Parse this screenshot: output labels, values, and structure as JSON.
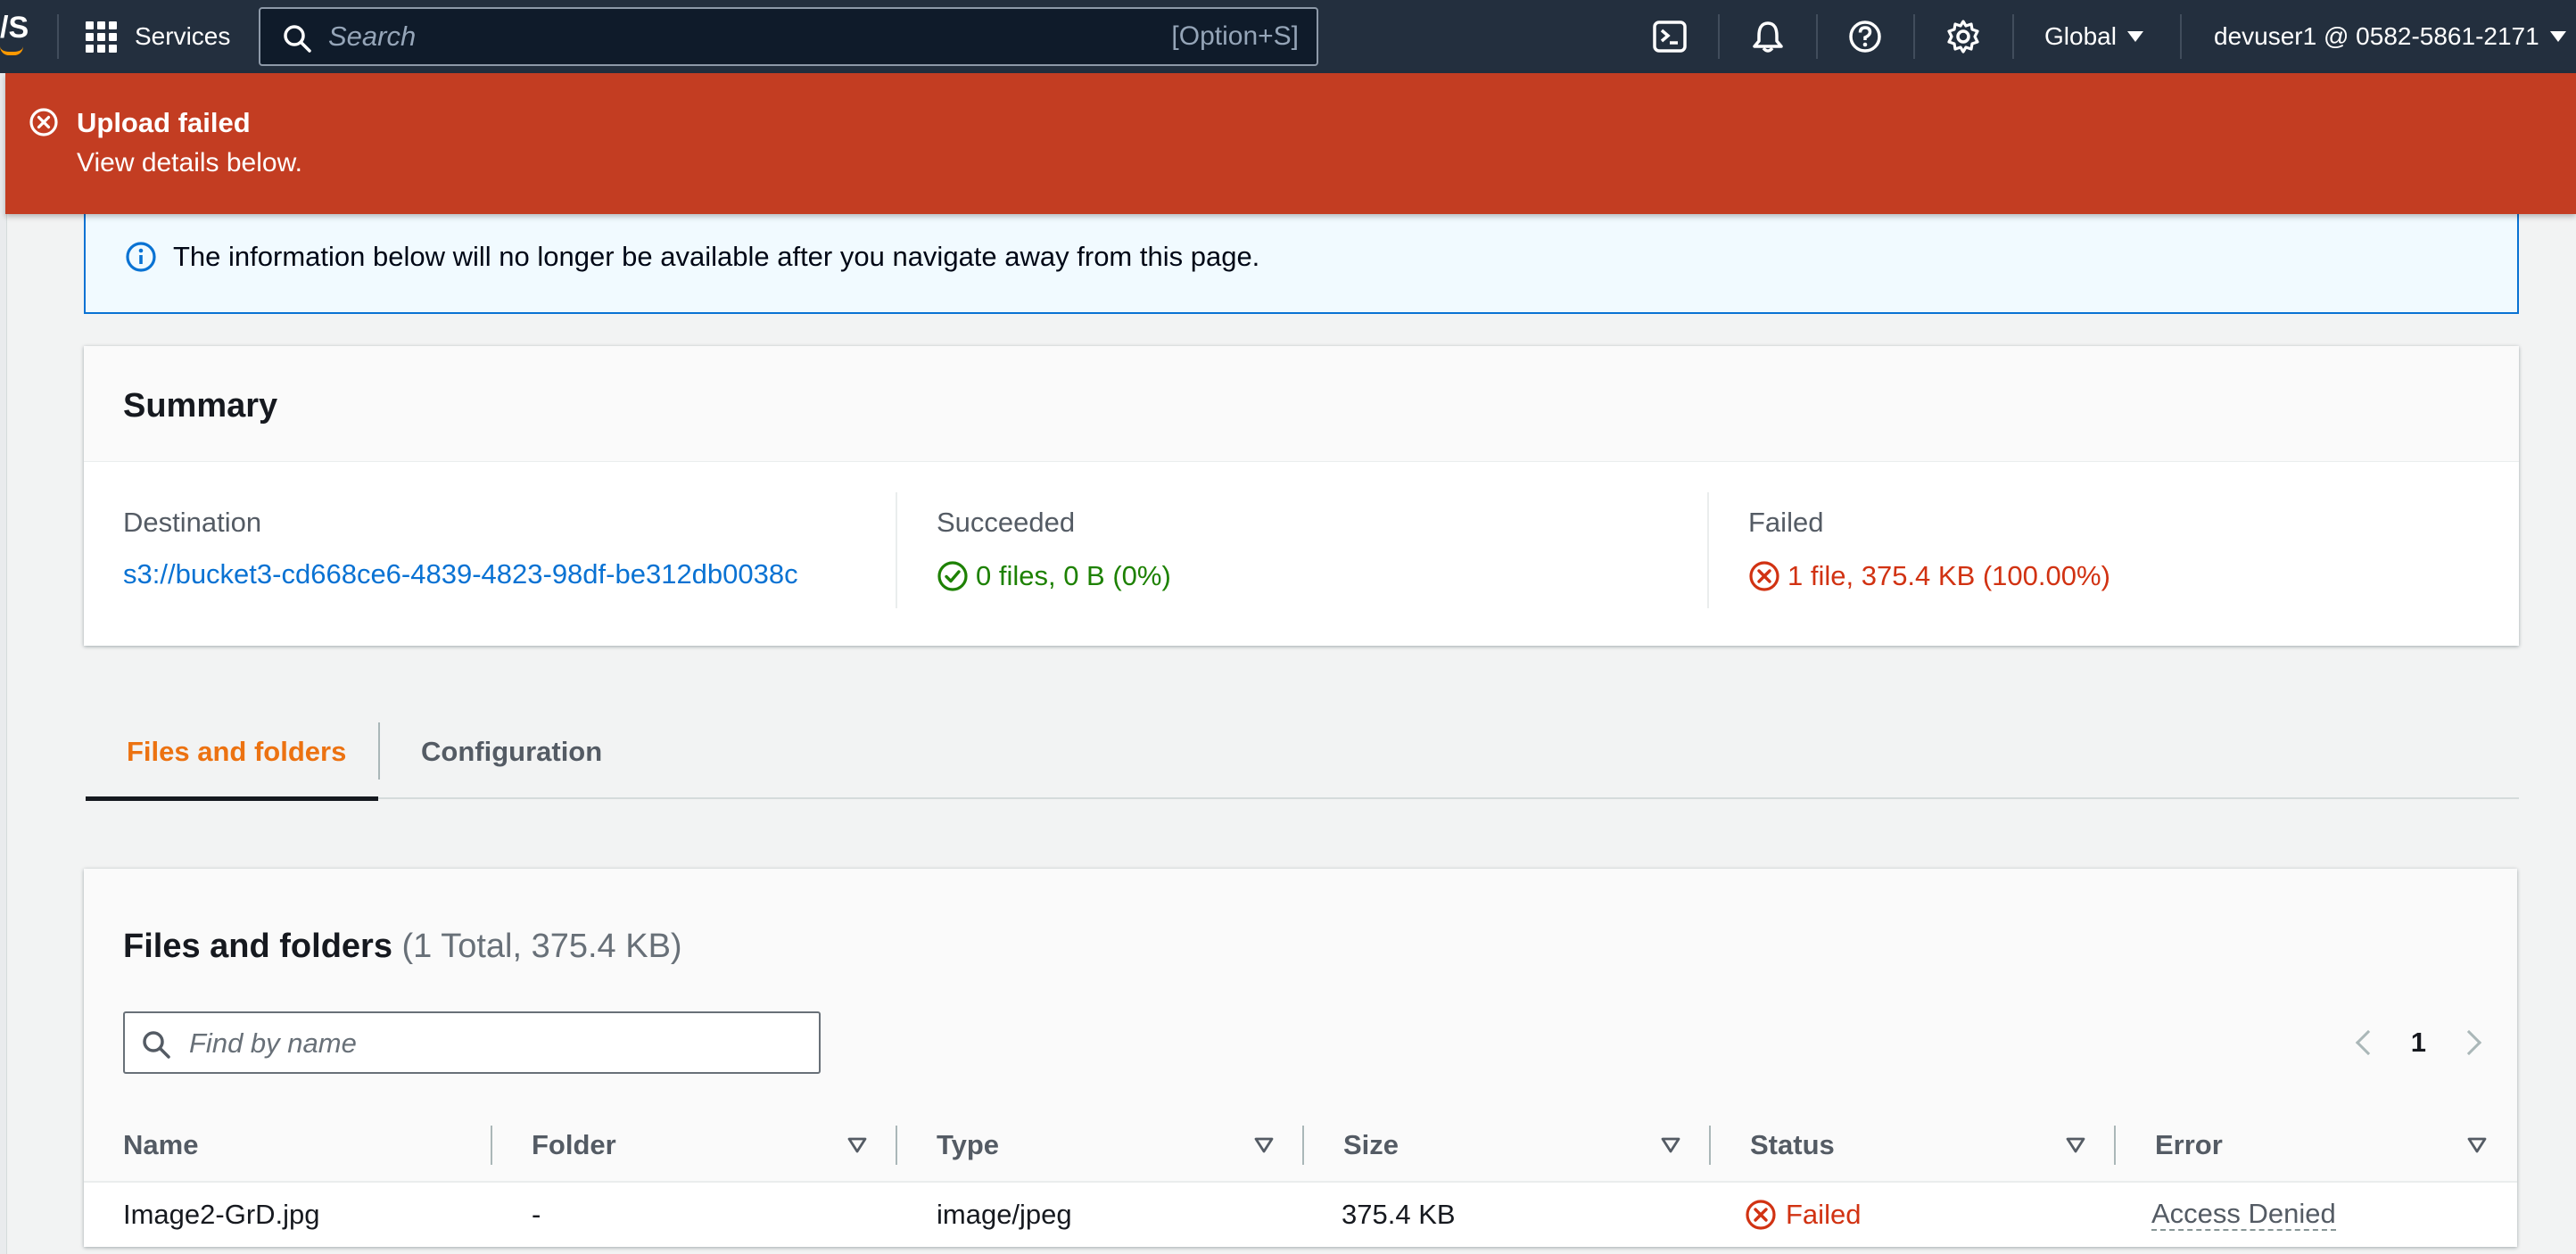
{
  "topnav": {
    "logo_fragment": "/S",
    "services_label": "Services",
    "search_placeholder": "Search",
    "search_shortcut": "[Option+S]",
    "region_label": "Global",
    "account_label": "devuser1 @ 0582-5861-2171",
    "icons": [
      "cloudshell-icon",
      "bell-icon",
      "help-icon",
      "settings-icon"
    ]
  },
  "flash": {
    "title": "Upload failed",
    "body": "View details below.",
    "color": "#c33d22"
  },
  "info_alert": {
    "text": "The information below will no longer be available after you navigate away from this page."
  },
  "summary": {
    "title": "Summary",
    "destination_label": "Destination",
    "destination_value": "s3://bucket3-cd668ce6-4839-4823-98df-be312db0038c",
    "succeeded_label": "Succeeded",
    "succeeded_value": "0 files, 0 B (0%)",
    "failed_label": "Failed",
    "failed_value": "1 file, 375.4 KB (100.00%)"
  },
  "tabs": [
    {
      "label": "Files and folders",
      "active": true
    },
    {
      "label": "Configuration",
      "active": false
    }
  ],
  "files": {
    "title": "Files and folders",
    "count": "(1 Total, 375.4 KB)",
    "find_placeholder": "Find by name",
    "page_number": "1",
    "columns": [
      "Name",
      "Folder",
      "Type",
      "Size",
      "Status",
      "Error"
    ],
    "rows": [
      {
        "name": "Image2-GrD.jpg",
        "folder": "-",
        "type": "image/jpeg",
        "size": "375.4 KB",
        "status": "Failed",
        "error": "Access Denied"
      }
    ]
  },
  "colors": {
    "nav_bg": "#232f3e",
    "error": "#d13212",
    "success": "#1d8102",
    "link": "#0972d3",
    "tab_active": "#ec7211"
  }
}
